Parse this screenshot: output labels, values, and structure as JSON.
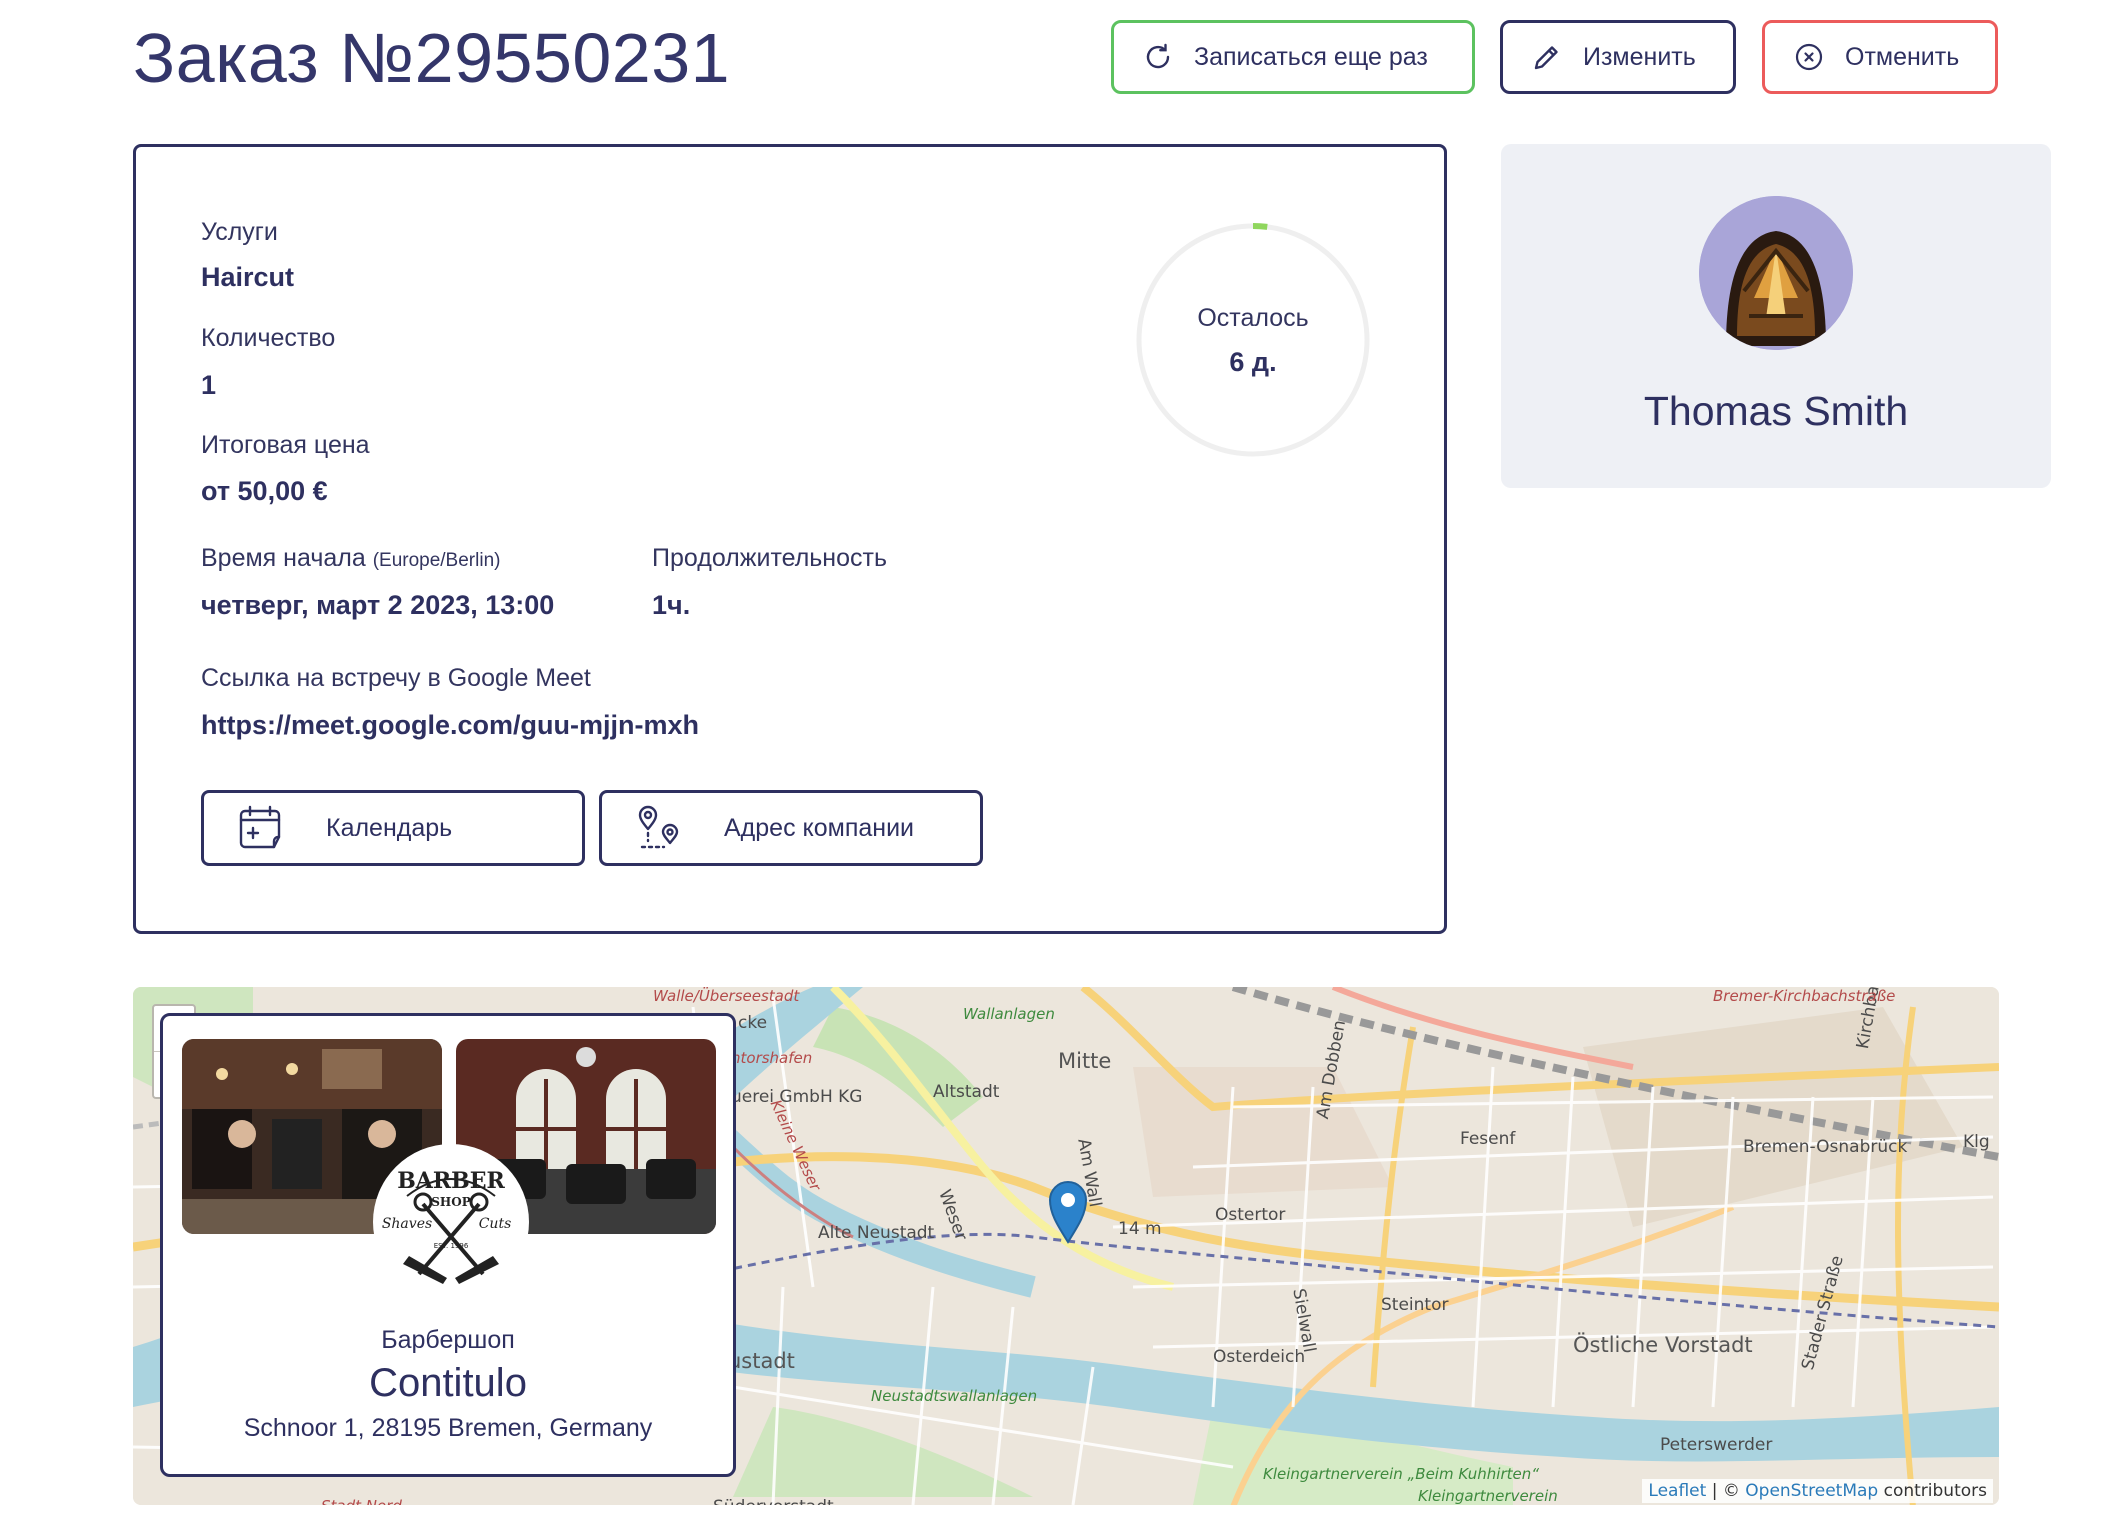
{
  "order": {
    "title": "Заказ №29550231",
    "actions": {
      "rebook": "Записаться еще раз",
      "edit": "Изменить",
      "cancel": "Отменить"
    },
    "services_label": "Услуги",
    "services_value": "Haircut",
    "quantity_label": "Количество",
    "quantity_value": "1",
    "price_label": "Итоговая цена",
    "price_value": "от 50,00 €",
    "start_label": "Время начала",
    "start_timezone": "(Europe/Berlin)",
    "start_value": "четверг, март 2 2023, 13:00",
    "duration_label": "Продолжительность",
    "duration_value": "1ч.",
    "meet_label": "Ссылка на встречу в Google Meet",
    "meet_value": "https://meet.google.com/guu-mjjn-mxh",
    "calendar_button": "Календарь",
    "address_button": "Адрес компании",
    "remaining_label": "Осталось",
    "remaining_value": "6 д.",
    "remaining_progress": 0.02
  },
  "provider": {
    "name": "Thomas Smith"
  },
  "company": {
    "type": "Барбершоп",
    "name": "Contitulo",
    "address": "Schnoor 1, 28195 Bremen, Germany",
    "logo_text": {
      "top": "BARBER",
      "middle": "SHOP",
      "left": "Shaves",
      "right": "Cuts",
      "est": "EST. 1996"
    }
  },
  "map": {
    "zoom_in": "+",
    "zoom_out": "−",
    "labels": [
      "Walle/Überseestadt",
      "Wallanlagen",
      "Mitte",
      "Altstadt",
      "Kleine Weser",
      "Alte Neustadt",
      "Ostertor",
      "Fesenf",
      "Steintor",
      "Östliche Vorstadt",
      "Osterdeich",
      "Peterswerder",
      "Neustadtswallanlagen",
      "Südervorstadt",
      "Stadt Nord",
      "Bremen-Osnabrück",
      "Kirchbachstraße",
      "Am Wall",
      "Am Dobben",
      "Sielwall",
      "Stader Straße",
      "Kleingartnerverein „Beim Kuhhirten“",
      "Kleingartnerverein",
      "Weser",
      "14 m",
      "Klg",
      "ustadt",
      "ntorshafen",
      "cke",
      "uerei GmbH KG",
      "Bremer-Kirchbachstraße"
    ],
    "attribution_leaflet": "Leaflet",
    "attribution_sep": " | © ",
    "attribution_osm": "OpenStreetMap",
    "attribution_rest": " contributors"
  },
  "colors": {
    "primary": "#2e3060",
    "green": "#5cc25f",
    "red": "#ec5b5b",
    "panel": "#eef0f5"
  }
}
